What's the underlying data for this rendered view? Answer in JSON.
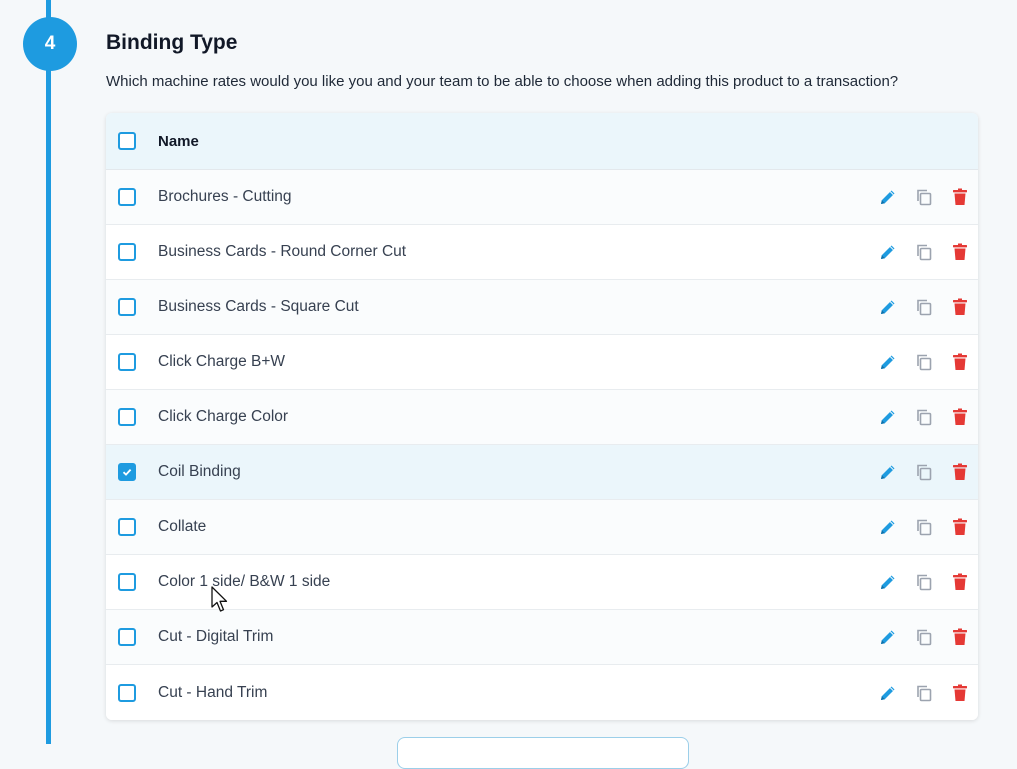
{
  "section": {
    "step_number": "4",
    "title": "Binding Type",
    "description": "Which machine rates would you like you and your team to be able to choose when adding this product to a transaction?"
  },
  "table": {
    "header": {
      "name_label": "Name",
      "all_checked": false
    },
    "rows": [
      {
        "label": "Brochures - Cutting",
        "checked": false
      },
      {
        "label": "Business Cards - Round Corner Cut",
        "checked": false
      },
      {
        "label": "Business Cards - Square Cut",
        "checked": false
      },
      {
        "label": "Click Charge B+W",
        "checked": false
      },
      {
        "label": "Click Charge Color",
        "checked": false
      },
      {
        "label": "Coil Binding",
        "checked": true
      },
      {
        "label": "Collate",
        "checked": false
      },
      {
        "label": "Color 1 side/ B&W 1 side",
        "checked": false
      },
      {
        "label": "Cut - Digital Trim",
        "checked": false
      },
      {
        "label": "Cut - Hand Trim",
        "checked": false
      }
    ],
    "row_actions": [
      "pencil-icon",
      "copy-icon",
      "trash-icon"
    ]
  },
  "colors": {
    "accent": "#1e9be0",
    "delete": "#e53935",
    "copy": "#9ca3af",
    "selected_row": "#ebf6fb"
  }
}
